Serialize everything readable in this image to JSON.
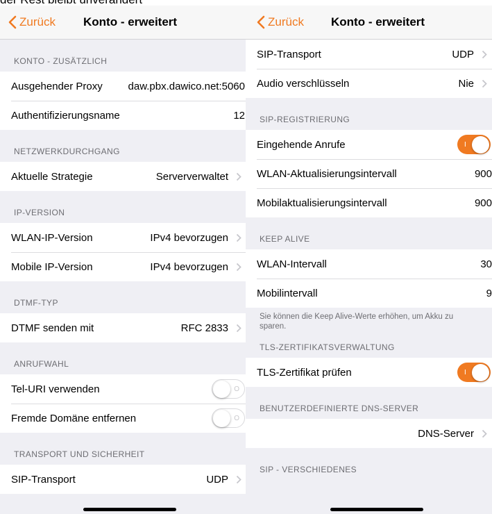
{
  "caption": "der Rest bleibt unverändert",
  "colors": {
    "accent": "#f07a21",
    "background": "#efeff4",
    "secondary_text": "#6d6d72"
  },
  "left": {
    "back": "Zurück",
    "title": "Konto - erweitert",
    "sections": {
      "konto": {
        "header": "KONTO - ZUSÄTZLICH",
        "proxy": {
          "label": "Ausgehender Proxy",
          "value": "daw.pbx.dawico.net:5060"
        },
        "auth": {
          "label": "Authentifizierungsname",
          "value": "12"
        }
      },
      "netz": {
        "header": "NETZWERKDURCHGANG",
        "strategy": {
          "label": "Aktuelle Strategie",
          "value": "Serververwaltet"
        }
      },
      "ip": {
        "header": "IP-VERSION",
        "wlan": {
          "label": "WLAN-IP-Version",
          "value": "IPv4 bevorzugen"
        },
        "mobile": {
          "label": "Mobile IP-Version",
          "value": "IPv4 bevorzugen"
        }
      },
      "dtmf": {
        "header": "DTMF-TYP",
        "send": {
          "label": "DTMF senden mit",
          "value": "RFC 2833"
        }
      },
      "anruf": {
        "header": "ANRUFWAHL",
        "teluri": {
          "label": "Tel-URI verwenden",
          "state": "off",
          "mark": "O"
        },
        "domain": {
          "label": "Fremde Domäne entfernen",
          "state": "off",
          "mark": "O"
        }
      },
      "transport": {
        "header": "TRANSPORT UND SICHERHEIT",
        "sip": {
          "label": "SIP-Transport",
          "value": "UDP"
        }
      }
    }
  },
  "right": {
    "back": "Zurück",
    "title": "Konto - erweitert",
    "rows": {
      "sip": {
        "label": "SIP-Transport",
        "value": "UDP"
      },
      "audio": {
        "label": "Audio verschlüsseln",
        "value": "Nie"
      }
    },
    "sections": {
      "reg": {
        "header": "SIP-REGISTRIERUNG",
        "incoming": {
          "label": "Eingehende Anrufe",
          "state": "on",
          "mark": "I"
        },
        "wlan": {
          "label": "WLAN-Aktualisierungsintervall",
          "value": "900"
        },
        "mobile": {
          "label": "Mobilaktualisierungsintervall",
          "value": "900"
        }
      },
      "keep": {
        "header": "KEEP ALIVE",
        "wlan": {
          "label": "WLAN-Intervall",
          "value": "30"
        },
        "mobile": {
          "label": "Mobilintervall",
          "value": "9"
        },
        "note": "Sie können die Keep Alive-Werte erhöhen, um Akku zu sparen."
      },
      "tls": {
        "header": "TLS-ZERTIFIKATSVERWALTUNG",
        "check": {
          "label": "TLS-Zertifikat prüfen",
          "state": "on",
          "mark": "I"
        }
      },
      "dns": {
        "header": "BENUTZERDEFINIERTE DNS-SERVER",
        "server": {
          "label": "",
          "value": "DNS-Server"
        }
      },
      "misc": {
        "header": "SIP - VERSCHIEDENES"
      }
    }
  }
}
